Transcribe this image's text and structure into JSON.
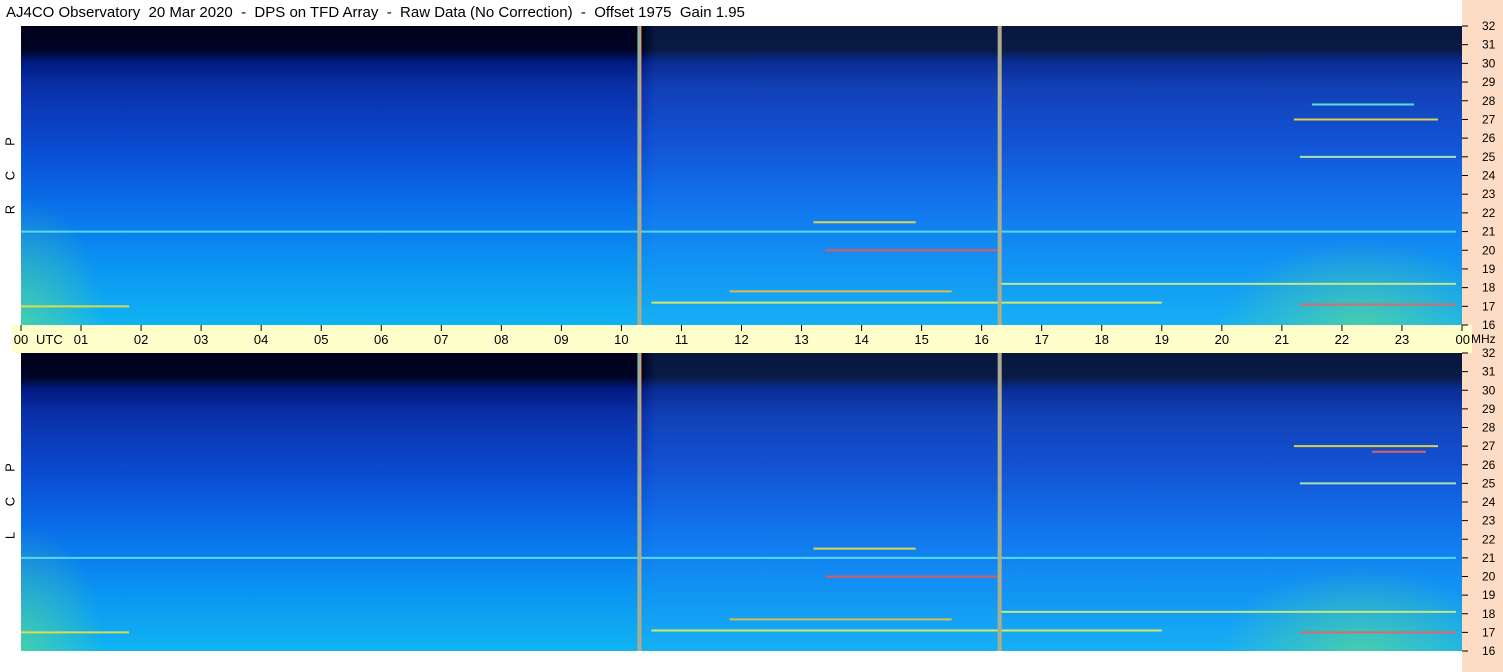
{
  "title": {
    "station": "AJ4CO Observatory",
    "date": "20 Mar 2020",
    "instrument": "DPS on TFD Array",
    "mode": "Raw Data (No Correction)",
    "offset": "Offset 1975",
    "gain": "Gain 1.95"
  },
  "chart_data": [
    {
      "type": "heatmap",
      "name": "RCP",
      "side_label": [
        "R",
        "C",
        "P"
      ],
      "xlabel": "UTC",
      "ylabel": "MHz",
      "xlim": [
        0,
        24
      ],
      "ylim": [
        16,
        32
      ],
      "x_tick_labels": [
        "00",
        "01",
        "02",
        "03",
        "04",
        "05",
        "06",
        "07",
        "08",
        "09",
        "10",
        "11",
        "12",
        "13",
        "14",
        "15",
        "16",
        "17",
        "18",
        "19",
        "20",
        "21",
        "22",
        "23",
        "00"
      ],
      "y_tick_labels": [
        "32",
        "31",
        "30",
        "29",
        "28",
        "27",
        "26",
        "25",
        "24",
        "23",
        "22",
        "21",
        "20",
        "19",
        "18",
        "17",
        "16"
      ],
      "calibration_markers_utc": [
        10.3,
        16.3
      ],
      "colors": {
        "low": "#000020",
        "mid": "#0a50d8",
        "high": "#10c8f0",
        "peak": "#f0e040",
        "max": "#e02020"
      },
      "interference_lines": [
        {
          "freq": 17.0,
          "start": 0.0,
          "end": 1.8,
          "color": "#f0e040"
        },
        {
          "freq": 17.1,
          "start": 21.3,
          "end": 23.9,
          "color": "#f06060"
        },
        {
          "freq": 17.2,
          "start": 10.5,
          "end": 19.0,
          "color": "#e8f060"
        },
        {
          "freq": 17.8,
          "start": 11.8,
          "end": 15.5,
          "color": "#f0c040"
        },
        {
          "freq": 18.2,
          "start": 16.3,
          "end": 23.9,
          "color": "#d0f080"
        },
        {
          "freq": 20.0,
          "start": 13.4,
          "end": 16.3,
          "color": "#ff5050"
        },
        {
          "freq": 21.0,
          "start": 0.0,
          "end": 23.9,
          "color": "#60e0f0"
        },
        {
          "freq": 21.5,
          "start": 13.2,
          "end": 14.9,
          "color": "#f0e040"
        },
        {
          "freq": 25.0,
          "start": 21.3,
          "end": 23.9,
          "color": "#c0f0a0"
        },
        {
          "freq": 27.0,
          "start": 21.2,
          "end": 23.6,
          "color": "#f0e040"
        },
        {
          "freq": 27.8,
          "start": 21.5,
          "end": 23.2,
          "color": "#60f0e0"
        }
      ]
    },
    {
      "type": "heatmap",
      "name": "LCP",
      "side_label": [
        "L",
        "C",
        "P"
      ],
      "xlabel": "UTC",
      "ylabel": "MHz",
      "xlim": [
        0,
        24
      ],
      "ylim": [
        16,
        32
      ],
      "x_tick_labels": [],
      "y_tick_labels": [
        "32",
        "31",
        "30",
        "29",
        "28",
        "27",
        "26",
        "25",
        "24",
        "23",
        "22",
        "21",
        "20",
        "19",
        "18",
        "17",
        "16"
      ],
      "calibration_markers_utc": [
        10.3,
        16.3
      ],
      "colors": {
        "low": "#000020",
        "mid": "#0a50d8",
        "high": "#10c8f0",
        "peak": "#f0e040",
        "max": "#e02020"
      },
      "interference_lines": [
        {
          "freq": 17.0,
          "start": 0.0,
          "end": 1.8,
          "color": "#f0e040"
        },
        {
          "freq": 17.0,
          "start": 21.3,
          "end": 23.9,
          "color": "#f06060"
        },
        {
          "freq": 17.1,
          "start": 10.5,
          "end": 19.0,
          "color": "#e8f060"
        },
        {
          "freq": 17.7,
          "start": 11.8,
          "end": 15.5,
          "color": "#f0c040"
        },
        {
          "freq": 18.1,
          "start": 16.3,
          "end": 23.9,
          "color": "#d0f080"
        },
        {
          "freq": 20.0,
          "start": 13.4,
          "end": 16.3,
          "color": "#ff5050"
        },
        {
          "freq": 21.0,
          "start": 0.0,
          "end": 23.9,
          "color": "#60e0f0"
        },
        {
          "freq": 21.5,
          "start": 13.2,
          "end": 14.9,
          "color": "#f0e040"
        },
        {
          "freq": 25.0,
          "start": 21.3,
          "end": 23.9,
          "color": "#c0f0a0"
        },
        {
          "freq": 26.7,
          "start": 22.5,
          "end": 23.4,
          "color": "#ff6050"
        },
        {
          "freq": 27.0,
          "start": 21.2,
          "end": 23.6,
          "color": "#f0e040"
        }
      ]
    }
  ]
}
